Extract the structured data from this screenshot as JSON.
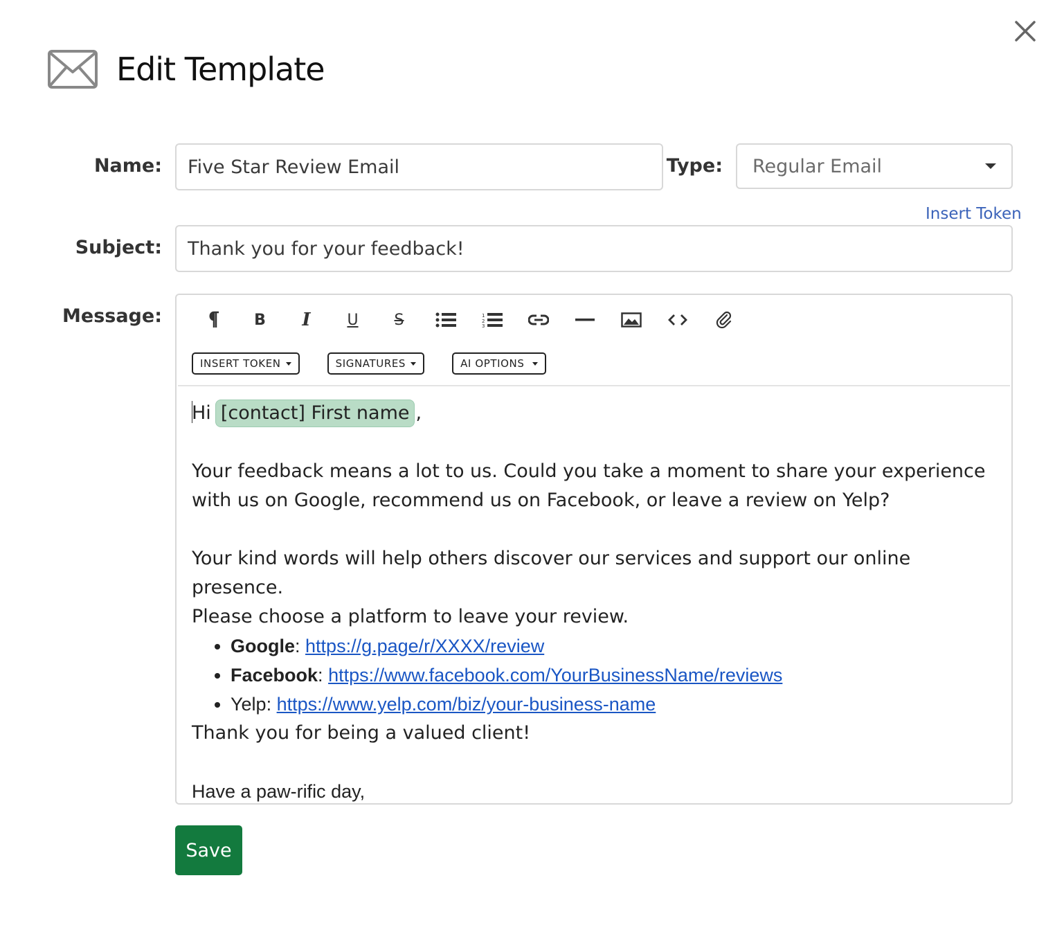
{
  "header": {
    "title": "Edit Template",
    "icon": "envelope-icon"
  },
  "close": {
    "icon": "close-icon"
  },
  "form": {
    "name_label": "Name:",
    "name_value": "Five Star Review Email",
    "type_label": "Type:",
    "type_value": "Regular Email",
    "insert_token_link": "Insert Token",
    "subject_label": "Subject:",
    "subject_value": "Thank you for your feedback!",
    "message_label": "Message:"
  },
  "toolbar": {
    "buttons": [
      {
        "name": "paragraph-icon"
      },
      {
        "name": "bold-icon",
        "glyph": "B"
      },
      {
        "name": "italic-icon",
        "glyph": "I"
      },
      {
        "name": "underline-icon",
        "glyph": "U"
      },
      {
        "name": "strikethrough-icon",
        "glyph": "S"
      },
      {
        "name": "bullet-list-icon"
      },
      {
        "name": "numbered-list-icon"
      },
      {
        "name": "link-icon"
      },
      {
        "name": "horizontal-rule-icon"
      },
      {
        "name": "image-icon"
      },
      {
        "name": "code-icon"
      },
      {
        "name": "attachment-icon"
      }
    ],
    "dropdowns": {
      "insert_token": "INSERT TOKEN",
      "signatures": "SIGNATURES",
      "ai_options": "AI OPTIONS"
    }
  },
  "message": {
    "greeting": "Hi",
    "token": "[contact] First name",
    "greeting_end": ",",
    "paragraph1": "Your feedback means a lot to us. Could you take a moment to share your experience with us on Google, recommend us on Facebook, or leave a review on Yelp?",
    "paragraph2_line1": "Your kind words will help others discover our services and support our online presence.",
    "paragraph2_line2": "Please choose a platform to leave your review.",
    "links": [
      {
        "platform": "Google",
        "separator": ":",
        "url": "https://g.page/r/XXXX/review",
        "bold": true
      },
      {
        "platform": "Facebook",
        "separator": ":",
        "url": "https://www.facebook.com/YourBusinessName/reviews",
        "bold": true
      },
      {
        "platform": "Yelp",
        "separator": ":",
        "url": "https://www.yelp.com/biz/your-business-name",
        "bold": false
      }
    ],
    "thanks": "Thank you for being a valued client!",
    "sign_off": "Have a paw-rific day,"
  },
  "actions": {
    "save": "Save"
  },
  "colors": {
    "save_bg": "#137a3e",
    "link": "#1a56c4",
    "token_link": "#3b63b9",
    "token_pill": "#b9dcc6"
  }
}
